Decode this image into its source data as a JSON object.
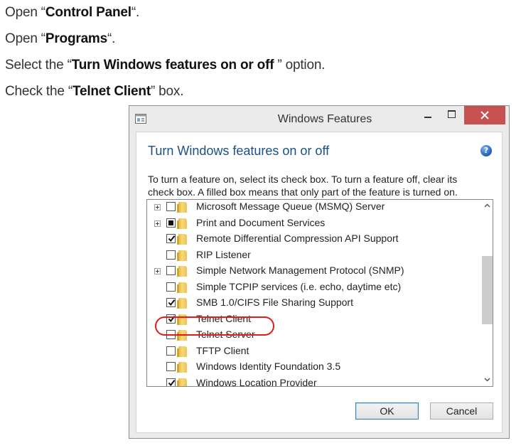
{
  "instructions": [
    {
      "prefix": "Open “",
      "bold": "Control Panel",
      "suffix": "“."
    },
    {
      "prefix": "Open “",
      "bold": "Programs",
      "suffix": "“."
    },
    {
      "prefix": "Select the “",
      "bold": "Turn Windows features on or off",
      "suffix": " ” option."
    },
    {
      "prefix": "Check the “",
      "bold": "Telnet Client",
      "suffix": "” box."
    }
  ],
  "window": {
    "title": "Windows Features",
    "heading": "Turn Windows features on or off",
    "help_icon": "?",
    "description_line1": "To turn a feature on, select its check box. To turn a feature off, clear its",
    "description_line2": "check box. A filled box means that only part of the feature is turned on.",
    "features": [
      {
        "label": "Microsoft Message Queue (MSMQ) Server",
        "state": "unchecked",
        "expandable": true
      },
      {
        "label": "Print and Document Services",
        "state": "partial",
        "expandable": true
      },
      {
        "label": "Remote Differential Compression API Support",
        "state": "checked",
        "expandable": false
      },
      {
        "label": "RIP Listener",
        "state": "unchecked",
        "expandable": false
      },
      {
        "label": "Simple Network Management Protocol (SNMP)",
        "state": "unchecked",
        "expandable": true
      },
      {
        "label": "Simple TCPIP services (i.e. echo, daytime etc)",
        "state": "unchecked",
        "expandable": false
      },
      {
        "label": "SMB 1.0/CIFS File Sharing Support",
        "state": "checked",
        "expandable": false
      },
      {
        "label": "Telnet Client",
        "state": "checked",
        "expandable": false
      },
      {
        "label": "Telnet Server",
        "state": "unchecked",
        "expandable": false
      },
      {
        "label": "TFTP Client",
        "state": "unchecked",
        "expandable": false
      },
      {
        "label": "Windows Identity Foundation 3.5",
        "state": "unchecked",
        "expandable": false
      },
      {
        "label": "Windows Location Provider",
        "state": "checked",
        "expandable": false
      }
    ],
    "ok_label": "OK",
    "cancel_label": "Cancel"
  },
  "colors": {
    "highlight_circle": "#e01b1b",
    "heading": "#1a4f8a",
    "close_button": "#c75050"
  }
}
